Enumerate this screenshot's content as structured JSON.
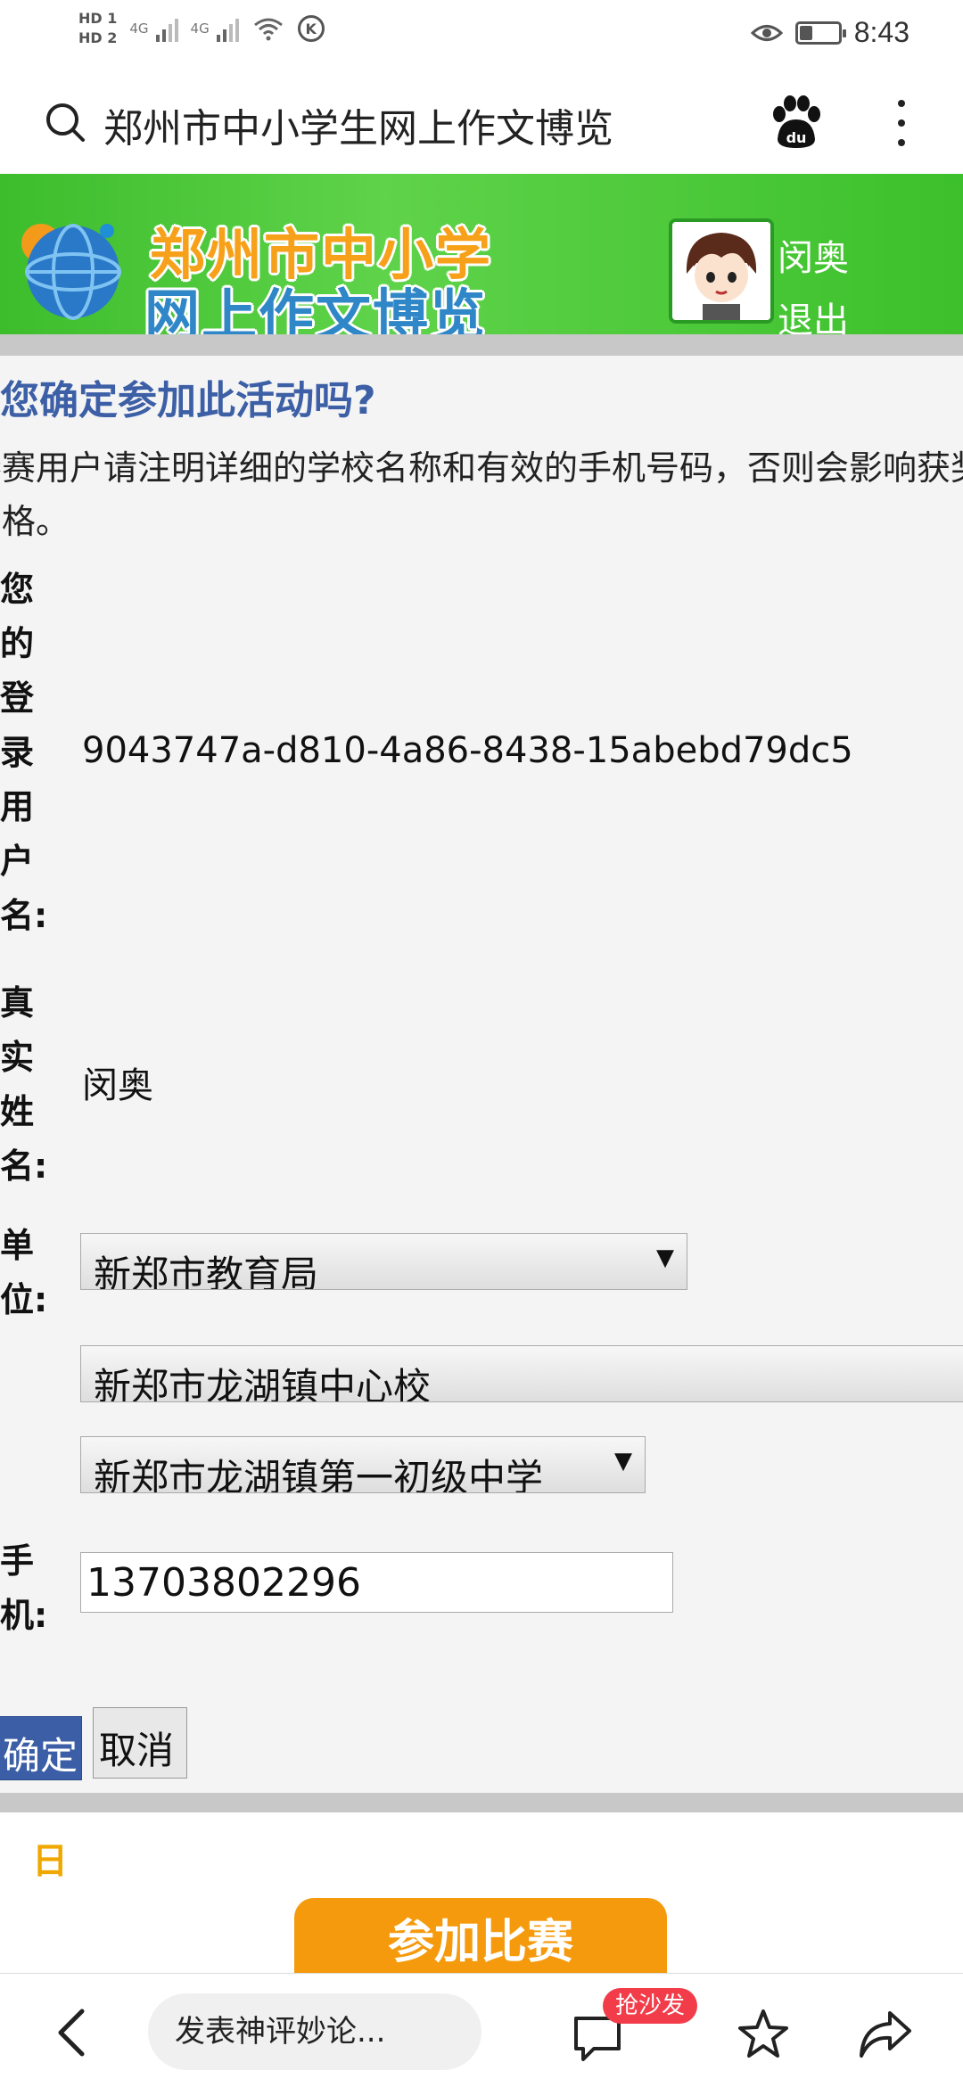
{
  "status_bar": {
    "hd1": "HD 1",
    "hd2": "HD 2",
    "signal1": "4G",
    "signal2": "4G",
    "time": "8:43",
    "k_label": "K"
  },
  "browser": {
    "page_heading": "郑州市中小学生网上作文博览",
    "baidu_label": "du"
  },
  "banner": {
    "logo_line1": "郑州市中小学",
    "logo_line2": "网上作文博览",
    "user_name": "闵奥",
    "logout": "退出"
  },
  "dialog": {
    "title": "您确定参加此活动吗?",
    "note": "参赛用户请注明详细的学校名称和有效的手机号码，否则会影响获奖资格。",
    "login_label": "您的登录用户名:",
    "login_value": "9043747a-d810-4a86-8438-15abebd79dc5",
    "realname_label": "真实姓名:",
    "realname_value": "闵奥",
    "unit_label": "单位:",
    "unit_select1": "新郑市教育局",
    "unit_select2": "新郑市龙湖镇中心校",
    "unit_select3": "新郑市龙湖镇第一初级中学",
    "phone_label": "手机:",
    "phone_value": "13703802296",
    "confirm": "确定",
    "cancel": "取消"
  },
  "lower": {
    "date_label": "日",
    "join_button": "参加比赛"
  },
  "bottom_nav": {
    "comment_placeholder": "发表神评妙论...",
    "sofa_badge": "抢沙发"
  },
  "colors": {
    "banner_green": "#4fc83a",
    "title_blue": "#3c5fa6",
    "confirm_blue": "#3b5ea6",
    "join_orange": "#f59a0c",
    "badge_red": "#f23c4a"
  }
}
